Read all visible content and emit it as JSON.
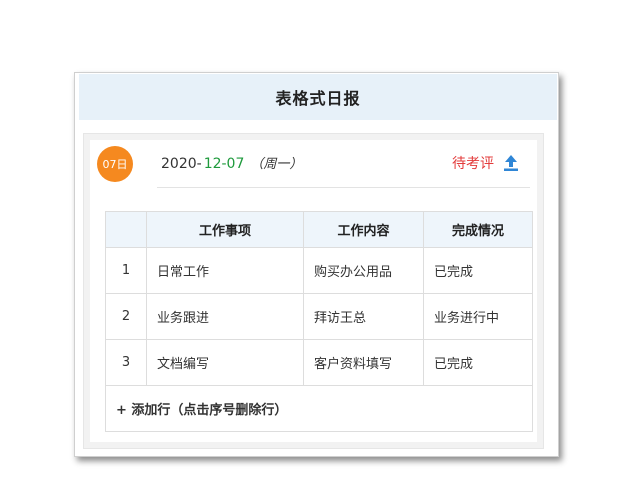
{
  "title": "表格式日报",
  "day_badge": "07日",
  "date": {
    "year_part": "2020-",
    "month_day": "12-07",
    "weekday": "（周一）"
  },
  "status_link": "待考评",
  "icons": {
    "upload": "upload-icon"
  },
  "colors": {
    "badge": "#f5891f",
    "status_link": "#e33b3b",
    "date_highlight": "#1e9a3c",
    "header_bg": "#e7f1f9"
  },
  "table": {
    "headers": [
      "",
      "工作事项",
      "工作内容",
      "完成情况"
    ],
    "rows": [
      {
        "index": "1",
        "item": "日常工作",
        "content": "购买办公用品",
        "status": "已完成"
      },
      {
        "index": "2",
        "item": "业务跟进",
        "content": "拜访王总",
        "status": "业务进行中"
      },
      {
        "index": "3",
        "item": "文档编写",
        "content": "客户资料填写",
        "status": "已完成"
      }
    ],
    "add_row_label": "+ 添加行（点击序号删除行）"
  }
}
